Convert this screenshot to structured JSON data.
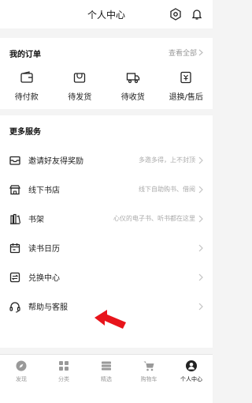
{
  "header": {
    "title": "个人中心",
    "settings_icon": "settings-hexagon-icon",
    "bell_icon": "bell-icon"
  },
  "orders": {
    "title": "我的订单",
    "view_all": "查看全部",
    "items": [
      {
        "label": "待付款",
        "icon": "wallet-icon"
      },
      {
        "label": "待发货",
        "icon": "package-icon"
      },
      {
        "label": "待收货",
        "icon": "truck-icon"
      },
      {
        "label": "退换/售后",
        "icon": "refund-icon"
      }
    ]
  },
  "services": {
    "title": "更多服务",
    "items": [
      {
        "label": "邀请好友得奖励",
        "hint": "多邀多得，上不封顶",
        "icon": "envelope-icon"
      },
      {
        "label": "线下书店",
        "hint": "线下自助购书、借阅",
        "icon": "store-icon"
      },
      {
        "label": "书架",
        "hint": "心仪的电子书、听书都在这里",
        "icon": "bookshelf-icon"
      },
      {
        "label": "读书日历",
        "hint": "",
        "icon": "calendar-icon"
      },
      {
        "label": "兑换中心",
        "hint": "",
        "icon": "exchange-icon"
      },
      {
        "label": "帮助与客服",
        "hint": "",
        "icon": "headset-icon"
      }
    ]
  },
  "annotation": {
    "arrow_color": "#e8141b"
  },
  "tabbar": {
    "items": [
      {
        "label": "发现",
        "icon": "compass-icon",
        "active": false
      },
      {
        "label": "分类",
        "icon": "grid-icon",
        "active": false
      },
      {
        "label": "精选",
        "icon": "stack-icon",
        "active": false
      },
      {
        "label": "购物车",
        "icon": "cart-icon",
        "active": false
      },
      {
        "label": "个人中心",
        "icon": "person-icon",
        "active": true
      }
    ]
  }
}
